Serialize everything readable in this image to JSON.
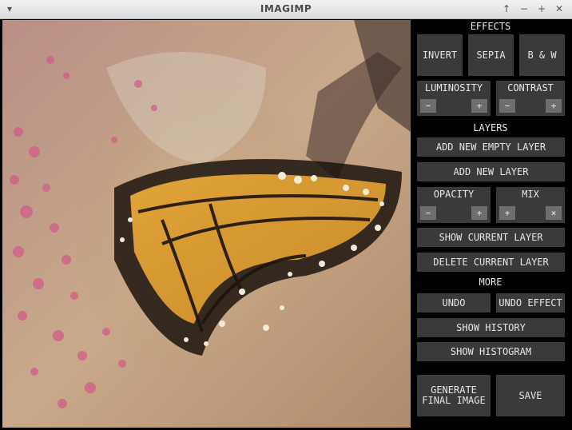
{
  "window": {
    "title": "IMAGIMP",
    "controls": [
      "↑",
      "−",
      "+",
      "✕"
    ],
    "menu_glyph": "▾"
  },
  "effects": {
    "header": "EFFECTS",
    "invert": "INVERT",
    "sepia": "SEPIA",
    "bw": "B & W",
    "luminosity": {
      "label": "LUMINOSITY",
      "minus": "−",
      "plus": "+"
    },
    "contrast": {
      "label": "CONTRAST",
      "minus": "−",
      "plus": "+"
    }
  },
  "layers": {
    "header": "LAYERS",
    "add_empty": "ADD NEW EMPTY LAYER",
    "add_new": "ADD NEW LAYER",
    "opacity": {
      "label": "OPACITY",
      "minus": "−",
      "plus": "+"
    },
    "mix": {
      "label": "MIX",
      "plus": "+",
      "times": "×"
    },
    "show_current": "SHOW CURRENT LAYER",
    "delete_current": "DELETE CURRENT LAYER"
  },
  "more": {
    "header": "MORE",
    "undo": "UNDO",
    "undo_effect": "UNDO EFFECT",
    "show_history": "SHOW HISTORY",
    "show_histogram": "SHOW HISTOGRAM",
    "generate_line1": "GENERATE",
    "generate_line2": "FINAL IMAGE",
    "save": "SAVE"
  }
}
